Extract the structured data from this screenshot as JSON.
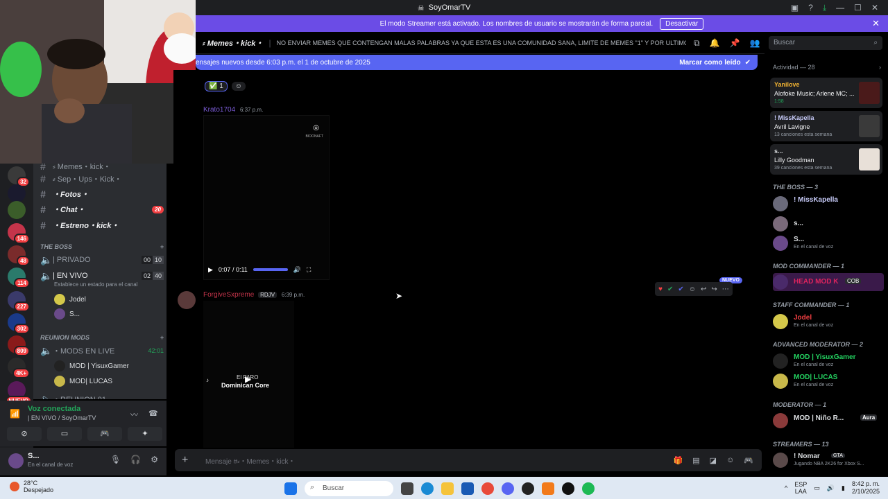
{
  "window": {
    "title": "SoyOmarTV"
  },
  "banner": {
    "text": "El modo Streamer está activado. Los nombres de usuario se mostrarán de forma parcial.",
    "button": "Desactivar"
  },
  "header": {
    "channel": "⸗ Memes・kick・",
    "topic": "NO ENVIAR MEMES QUE CONTENGAN MALAS PALABRAS YA QUE ESTA ES UNA COMUNIDAD SANA, LIMITE DE MEMES \"1\" Y POR ULTIMO EL ...",
    "search_placeholder": "Buscar"
  },
  "new_messages": {
    "text": "ensajes nuevos desde 6:03 p.m. el 1 de octubre de 2025",
    "action": "Marcar como leído"
  },
  "servers": [
    {
      "badge": "32",
      "color": "#3a3a3a"
    },
    {
      "badge": "",
      "color": "#1a1a2e"
    },
    {
      "badge": "",
      "color": "#3b5d2a"
    },
    {
      "badge": "146",
      "color": "#c4344a"
    },
    {
      "badge": "48",
      "color": "#7a2b2b"
    },
    {
      "badge": "114",
      "color": "#2a7a6b"
    },
    {
      "badge": "227",
      "color": "#3a3a6a"
    },
    {
      "badge": "302",
      "color": "#1a3a8a"
    },
    {
      "badge": "809",
      "color": "#8a1a1a"
    },
    {
      "badge": "4K+",
      "color": "#2a2a2a"
    },
    {
      "badge": "NUEVO",
      "color": "#5a1a5a"
    }
  ],
  "channels": {
    "items": [
      {
        "name": "⸗ Memes・kick・",
        "count": ""
      },
      {
        "name": "⸗ Sep・Ups・Kick・",
        "count": ""
      },
      {
        "name": "・Fotos・",
        "count": ""
      },
      {
        "name": "・Chat・",
        "count": "20"
      },
      {
        "name": "・Estreno・kick・",
        "count": ""
      }
    ],
    "cat_boss": "THE BOSS",
    "privado": {
      "name": "| PRIVADO",
      "a": "00",
      "b": "10"
    },
    "envivo": {
      "name": "| EN VIVO",
      "a": "02",
      "b": "40"
    },
    "envivo_status": "Establece un estado para el canal",
    "voice_users": [
      "Jodel",
      "S..."
    ],
    "cat_mods": "REUNION MODS",
    "mods_live": {
      "name": "・MODS EN LIVE",
      "time": "42:01"
    },
    "mod_users": [
      "MOD | YisuxGamer",
      "MOD| LUCAS"
    ],
    "reunion01": "・REUNION 01"
  },
  "voice": {
    "status": "Voz conectada",
    "channel": "| EN VIVO / SoyOmarTV"
  },
  "user": {
    "name": "S...",
    "status": "En el canal de voz"
  },
  "messages": {
    "reaction_count": "1",
    "msg1": {
      "author": "Krato1704",
      "time": "6:37 p.m."
    },
    "video1": {
      "time": "0:07 / 0:11",
      "watermark": "BIOONAFT"
    },
    "msg2": {
      "author": "ForgiveSxpreme",
      "tag": "RDJV",
      "time": "6:39 p.m."
    },
    "video2_caption": "Dominican Core",
    "video2_title": "El PARO",
    "new_tag": "NUEVO"
  },
  "input": {
    "placeholder": "Mensaje #⸗・Memes・kick・"
  },
  "members": {
    "activity_header": "Actividad — 28",
    "activity": [
      {
        "name": "Yanilove",
        "title": "Alofoke Music; Arlene MC; ...",
        "sub": "1:58",
        "color": "#f0b232"
      },
      {
        "name": "! MissKapella",
        "title": "Avril Lavigne",
        "sub": "13 canciones esta semana",
        "color": "#dbdee1"
      },
      {
        "name": "s...",
        "title": "Lilly Goodman",
        "sub": "39 canciones esta semana",
        "color": "#dbdee1"
      }
    ],
    "role_boss": "THE BOSS — 3",
    "boss": [
      {
        "name": "! MissKapella",
        "status": "",
        "color": "#c9cdfb"
      },
      {
        "name": "s...",
        "status": "",
        "color": "#dbdee1"
      },
      {
        "name": "S...",
        "status": "En el canal de voz",
        "color": "#dbdee1"
      }
    ],
    "role_mod_commander": "MOD COMMANDER — 1",
    "mod_commander": {
      "name": "HEAD MOD K",
      "tag": "COB",
      "color": "#e0245e"
    },
    "role_staff": "STAFF COMMANDER — 1",
    "staff": {
      "name": "Jodel",
      "status": "En el canal de voz",
      "color": "#f23f42"
    },
    "role_adv": "ADVANCED MODERATOR — 2",
    "adv": [
      {
        "name": "MOD | YisuxGamer",
        "status": "En el canal de voz",
        "color": "#23d160"
      },
      {
        "name": "MOD| LUCAS",
        "status": "En el canal de voz",
        "color": "#23d160"
      }
    ],
    "role_moderator": "MODERATOR — 1",
    "moderator": {
      "name": "MOD | Niño R...",
      "tag": "Aura",
      "color": "#dbdee1"
    },
    "role_streamers": "STREAMERS — 13",
    "streamer": {
      "name": "! Nomar",
      "tag": "GTA",
      "status": "Jugando NBA 2K26 for Xbox S...",
      "color": "#dbdee1"
    }
  },
  "taskbar": {
    "temp": "28°C",
    "weather": "Despejado",
    "search": "Buscar",
    "lang1": "ESP",
    "lang2": "LAA",
    "time": "8:42 p. m.",
    "date": "2/10/2025"
  }
}
